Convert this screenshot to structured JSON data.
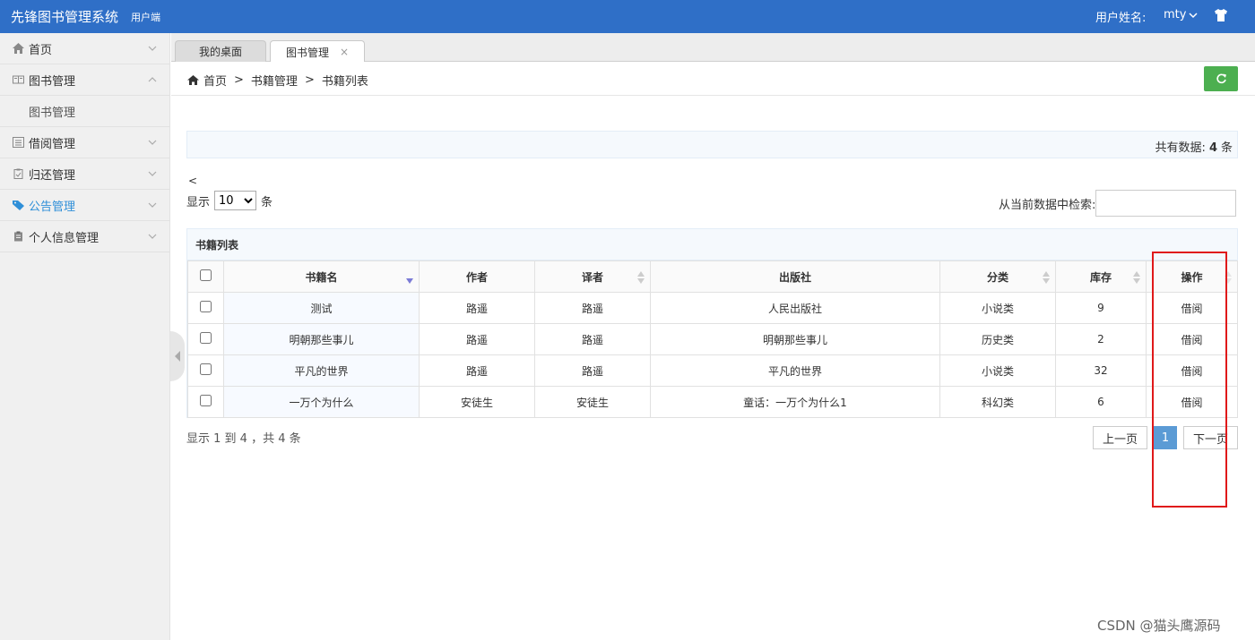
{
  "header": {
    "app_title": "先锋图书管理系统",
    "app_subtitle": "用户端",
    "user_label": "用户姓名:",
    "user_name": "mty"
  },
  "sidebar": {
    "items": [
      {
        "label": "首页",
        "icon": "home-icon"
      },
      {
        "label": "图书管理",
        "icon": "book-icon",
        "expanded": true
      },
      {
        "label": "借阅管理",
        "icon": "list-icon"
      },
      {
        "label": "归还管理",
        "icon": "clipboard-icon"
      },
      {
        "label": "公告管理",
        "icon": "tag-icon",
        "active": true
      },
      {
        "label": "个人信息管理",
        "icon": "clipboard-icon"
      }
    ],
    "sub_items": [
      "图书管理"
    ]
  },
  "tabs": [
    {
      "label": "我的桌面"
    },
    {
      "label": "图书管理",
      "active": true,
      "close": "×"
    }
  ],
  "breadcrumb": {
    "home": "首页",
    "sep": ">",
    "level2": "书籍管理",
    "level3": "书籍列表"
  },
  "info": {
    "total_label": "共有数据:",
    "total_count": "4",
    "total_unit": "条"
  },
  "lt_glyph": "<",
  "length": {
    "prefix": "显示",
    "selected": "10",
    "suffix": "条"
  },
  "search": {
    "label": "从当前数据中检索:",
    "value": ""
  },
  "table": {
    "caption": "书籍列表",
    "columns": [
      "书籍名",
      "作者",
      "译者",
      "出版社",
      "分类",
      "库存",
      "操作"
    ],
    "rows": [
      [
        "测试",
        "路遥",
        "路遥",
        "人民出版社",
        "小说类",
        "9",
        "借阅"
      ],
      [
        "明朝那些事儿",
        "路遥",
        "路遥",
        "明朝那些事儿",
        "历史类",
        "2",
        "借阅"
      ],
      [
        "平凡的世界",
        "路遥",
        "路遥",
        "平凡的世界",
        "小说类",
        "32",
        "借阅"
      ],
      [
        "一万个为什么",
        "安徒生",
        "安徒生",
        "童话：一万个为什么1",
        "科幻类",
        "6",
        "借阅"
      ]
    ]
  },
  "footer": {
    "info": "显示 1 到 4 ，共 4 条",
    "prev": "上一页",
    "page": "1",
    "next": "下一页"
  },
  "watermark": "CSDN @猫头鹰源码",
  "colors": {
    "header_bg": "#2f6fc7",
    "accent_green": "#4caf50",
    "page_active": "#5b9bd5",
    "annotation_red": "#e0191a"
  }
}
